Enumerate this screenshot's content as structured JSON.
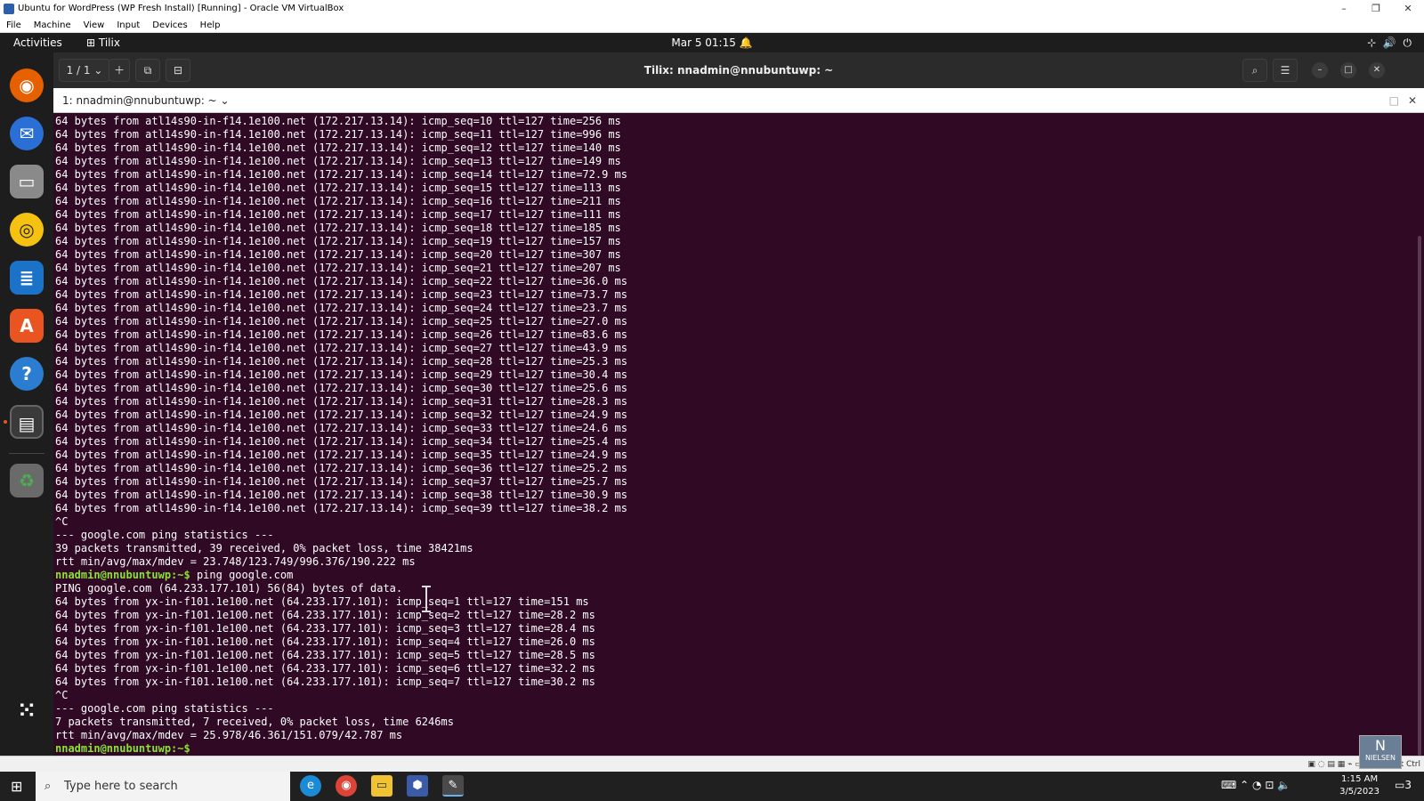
{
  "vbox": {
    "title": "Ubuntu for WordPress (WP Fresh Install) [Running] - Oracle VM VirtualBox",
    "menu": [
      "File",
      "Machine",
      "View",
      "Input",
      "Devices",
      "Help"
    ],
    "status_host_key": "ht Ctrl"
  },
  "gnome": {
    "activities": "Activities",
    "app_name": "Tilix",
    "clock": "Mar 5  01:15"
  },
  "tilix": {
    "session_counter": "1 / 1",
    "window_title": "Tilix: nnadmin@nnubuntuwp: ~",
    "session_label": "1: nnadmin@nnubuntuwp: ~"
  },
  "terminal": {
    "lines": [
      "64 bytes from atl14s90-in-f14.1e100.net (172.217.13.14): icmp_seq=10 ttl=127 time=256 ms",
      "64 bytes from atl14s90-in-f14.1e100.net (172.217.13.14): icmp_seq=11 ttl=127 time=996 ms",
      "64 bytes from atl14s90-in-f14.1e100.net (172.217.13.14): icmp_seq=12 ttl=127 time=140 ms",
      "64 bytes from atl14s90-in-f14.1e100.net (172.217.13.14): icmp_seq=13 ttl=127 time=149 ms",
      "64 bytes from atl14s90-in-f14.1e100.net (172.217.13.14): icmp_seq=14 ttl=127 time=72.9 ms",
      "64 bytes from atl14s90-in-f14.1e100.net (172.217.13.14): icmp_seq=15 ttl=127 time=113 ms",
      "64 bytes from atl14s90-in-f14.1e100.net (172.217.13.14): icmp_seq=16 ttl=127 time=211 ms",
      "64 bytes from atl14s90-in-f14.1e100.net (172.217.13.14): icmp_seq=17 ttl=127 time=111 ms",
      "64 bytes from atl14s90-in-f14.1e100.net (172.217.13.14): icmp_seq=18 ttl=127 time=185 ms",
      "64 bytes from atl14s90-in-f14.1e100.net (172.217.13.14): icmp_seq=19 ttl=127 time=157 ms",
      "64 bytes from atl14s90-in-f14.1e100.net (172.217.13.14): icmp_seq=20 ttl=127 time=307 ms",
      "64 bytes from atl14s90-in-f14.1e100.net (172.217.13.14): icmp_seq=21 ttl=127 time=207 ms",
      "64 bytes from atl14s90-in-f14.1e100.net (172.217.13.14): icmp_seq=22 ttl=127 time=36.0 ms",
      "64 bytes from atl14s90-in-f14.1e100.net (172.217.13.14): icmp_seq=23 ttl=127 time=73.7 ms",
      "64 bytes from atl14s90-in-f14.1e100.net (172.217.13.14): icmp_seq=24 ttl=127 time=23.7 ms",
      "64 bytes from atl14s90-in-f14.1e100.net (172.217.13.14): icmp_seq=25 ttl=127 time=27.0 ms",
      "64 bytes from atl14s90-in-f14.1e100.net (172.217.13.14): icmp_seq=26 ttl=127 time=83.6 ms",
      "64 bytes from atl14s90-in-f14.1e100.net (172.217.13.14): icmp_seq=27 ttl=127 time=43.9 ms",
      "64 bytes from atl14s90-in-f14.1e100.net (172.217.13.14): icmp_seq=28 ttl=127 time=25.3 ms",
      "64 bytes from atl14s90-in-f14.1e100.net (172.217.13.14): icmp_seq=29 ttl=127 time=30.4 ms",
      "64 bytes from atl14s90-in-f14.1e100.net (172.217.13.14): icmp_seq=30 ttl=127 time=25.6 ms",
      "64 bytes from atl14s90-in-f14.1e100.net (172.217.13.14): icmp_seq=31 ttl=127 time=28.3 ms",
      "64 bytes from atl14s90-in-f14.1e100.net (172.217.13.14): icmp_seq=32 ttl=127 time=24.9 ms",
      "64 bytes from atl14s90-in-f14.1e100.net (172.217.13.14): icmp_seq=33 ttl=127 time=24.6 ms",
      "64 bytes from atl14s90-in-f14.1e100.net (172.217.13.14): icmp_seq=34 ttl=127 time=25.4 ms",
      "64 bytes from atl14s90-in-f14.1e100.net (172.217.13.14): icmp_seq=35 ttl=127 time=24.9 ms",
      "64 bytes from atl14s90-in-f14.1e100.net (172.217.13.14): icmp_seq=36 ttl=127 time=25.2 ms",
      "64 bytes from atl14s90-in-f14.1e100.net (172.217.13.14): icmp_seq=37 ttl=127 time=25.7 ms",
      "64 bytes from atl14s90-in-f14.1e100.net (172.217.13.14): icmp_seq=38 ttl=127 time=30.9 ms",
      "64 bytes from atl14s90-in-f14.1e100.net (172.217.13.14): icmp_seq=39 ttl=127 time=38.2 ms",
      "^C",
      "--- google.com ping statistics ---",
      "39 packets transmitted, 39 received, 0% packet loss, time 38421ms",
      "rtt min/avg/max/mdev = 23.748/123.749/996.376/190.222 ms",
      "",
      "PING google.com (64.233.177.101) 56(84) bytes of data.",
      "64 bytes from yx-in-f101.1e100.net (64.233.177.101): icmp_seq=1 ttl=127 time=151 ms",
      "64 bytes from yx-in-f101.1e100.net (64.233.177.101): icmp_seq=2 ttl=127 time=28.2 ms",
      "64 bytes from yx-in-f101.1e100.net (64.233.177.101): icmp_seq=3 ttl=127 time=28.4 ms",
      "64 bytes from yx-in-f101.1e100.net (64.233.177.101): icmp_seq=4 ttl=127 time=26.0 ms",
      "64 bytes from yx-in-f101.1e100.net (64.233.177.101): icmp_seq=5 ttl=127 time=28.5 ms",
      "64 bytes from yx-in-f101.1e100.net (64.233.177.101): icmp_seq=6 ttl=127 time=32.2 ms",
      "64 bytes from yx-in-f101.1e100.net (64.233.177.101): icmp_seq=7 ttl=127 time=30.2 ms",
      "^C",
      "--- google.com ping statistics ---",
      "7 packets transmitted, 7 received, 0% packet loss, time 6246ms",
      "rtt min/avg/max/mdev = 25.978/46.361/151.079/42.787 ms",
      ""
    ],
    "prompt": "nnadmin@nnubuntuwp:~$",
    "command": " ping google.com"
  },
  "taskbar": {
    "search_placeholder": "Type here to search",
    "time": "1:15 AM",
    "date": "3/5/2023",
    "notifications": "3"
  },
  "watermark": "NIELSEN",
  "colors": {
    "terminal_bg": "#300a24",
    "prompt": "#8ae234",
    "dock_bg": "#1d1d1d"
  }
}
